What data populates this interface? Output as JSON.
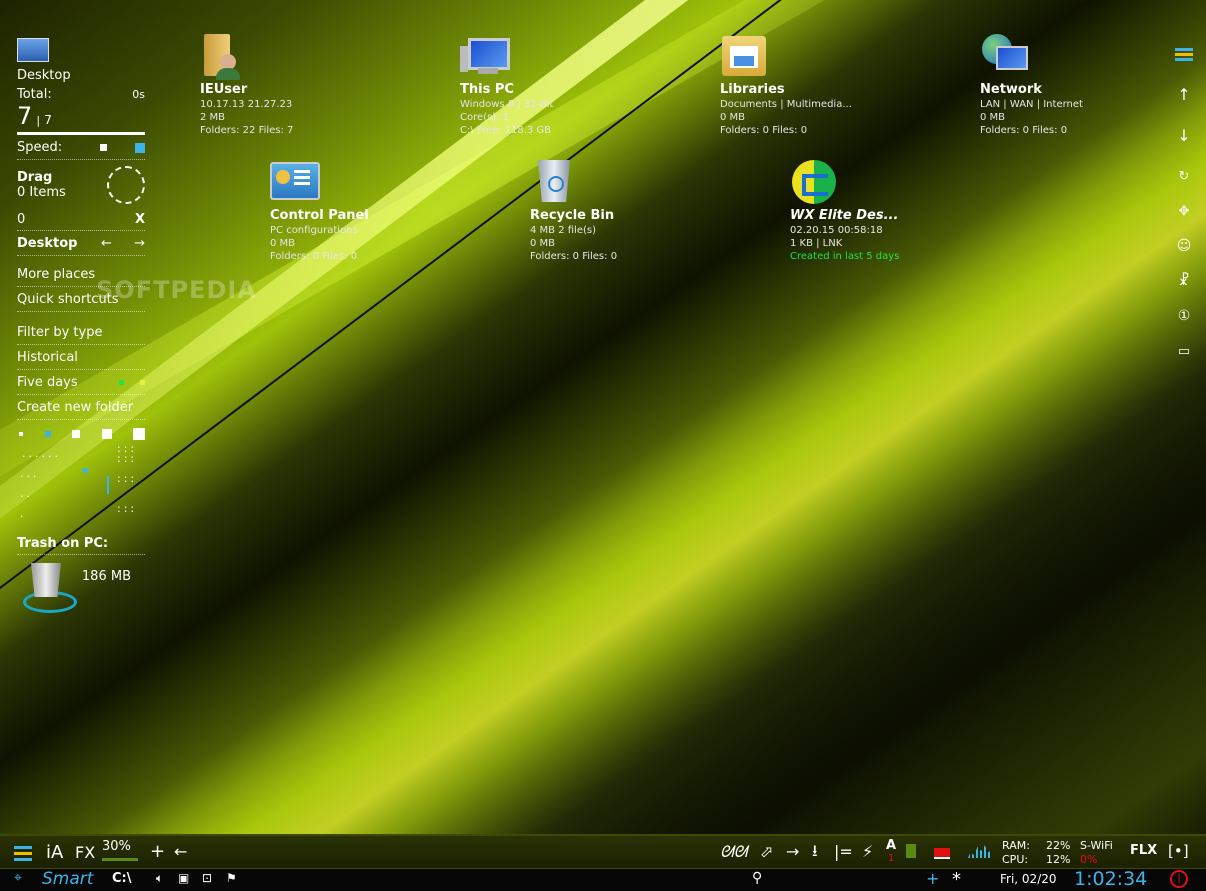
{
  "sidebar": {
    "location": "Desktop",
    "total_label": "Total:",
    "total_time": "0s",
    "total_count": "7",
    "total_sep": "|",
    "total_of": "7",
    "speed_label": "Speed:",
    "drag_label": "Drag",
    "drag_items": "0 Items",
    "selected_count": "0",
    "close_x": "X",
    "nav_title": "Desktop",
    "back_arrow": "←",
    "forward_arrow": "→",
    "menu": [
      "More places",
      "Quick shortcuts",
      "Filter by type",
      "Historical",
      "Five days",
      "Create new folder"
    ],
    "trash_label": "Trash on PC:",
    "trash_size": "186 MB"
  },
  "desktop_icons": [
    {
      "name": "IEUser",
      "lines": [
        "10.17.13  21.27.23",
        "2 MB",
        "Folders: 22  Files: 7"
      ],
      "icon": "user-folder-icon"
    },
    {
      "name": "This PC",
      "lines": [
        "Windows 8 | 32-Bit",
        "Core(s): 1",
        "C:\\  Free: 118.3 GB"
      ],
      "icon": "computer-icon"
    },
    {
      "name": "Libraries",
      "lines": [
        "Documents | Multimedia...",
        "0 MB",
        "Folders: 0  Files: 0"
      ],
      "icon": "libraries-icon"
    },
    {
      "name": "Network",
      "lines": [
        "LAN | WAN | Internet",
        "0 MB",
        "Folders: 0  Files: 0"
      ],
      "icon": "network-icon"
    },
    {
      "name": "Control Panel",
      "lines": [
        "PC configurations",
        "0 MB",
        "Folders: 0  Files: 0"
      ],
      "icon": "control-panel-icon"
    },
    {
      "name": "Recycle Bin",
      "lines": [
        "4 MB   2 file(s)",
        "0 MB",
        "Folders: 0  Files: 0"
      ],
      "icon": "recycle-bin-icon"
    },
    {
      "name": "WX Elite Des...",
      "lines": [
        "02.20.15   00:58:18",
        "1 KB  |  LNK",
        "Created in last 5 days"
      ],
      "icon": "wx-elite-icon"
    }
  ],
  "watermark": "SOFTPEDIA",
  "right_bar": [
    "≡",
    "↑",
    "↓",
    "↻",
    "✥",
    "☺",
    "☧",
    "①",
    "▭"
  ],
  "toolbar": {
    "ia": "iA",
    "fx": "FX",
    "percent": "30%",
    "plus": "+",
    "back": "←",
    "ram_label": "RAM:",
    "cpu_label": "CPU:",
    "ram_val": "22%",
    "cpu_val": "12%",
    "wifi_label": "S-WiFi",
    "wifi_val": "0%",
    "flx": "FLX",
    "bracket": "[•]",
    "a_label": "A",
    "a_sub": "1"
  },
  "taskbar": {
    "smart": "Smart",
    "drive": "C:\\",
    "date": "Fri, 02/20",
    "time": "1:02:34",
    "plus": "+",
    "star": "*"
  },
  "colors": {
    "accent": "#3bb4e8",
    "green": "#1ee63a",
    "red": "#e01010",
    "bar_green": "#5a8a10"
  }
}
